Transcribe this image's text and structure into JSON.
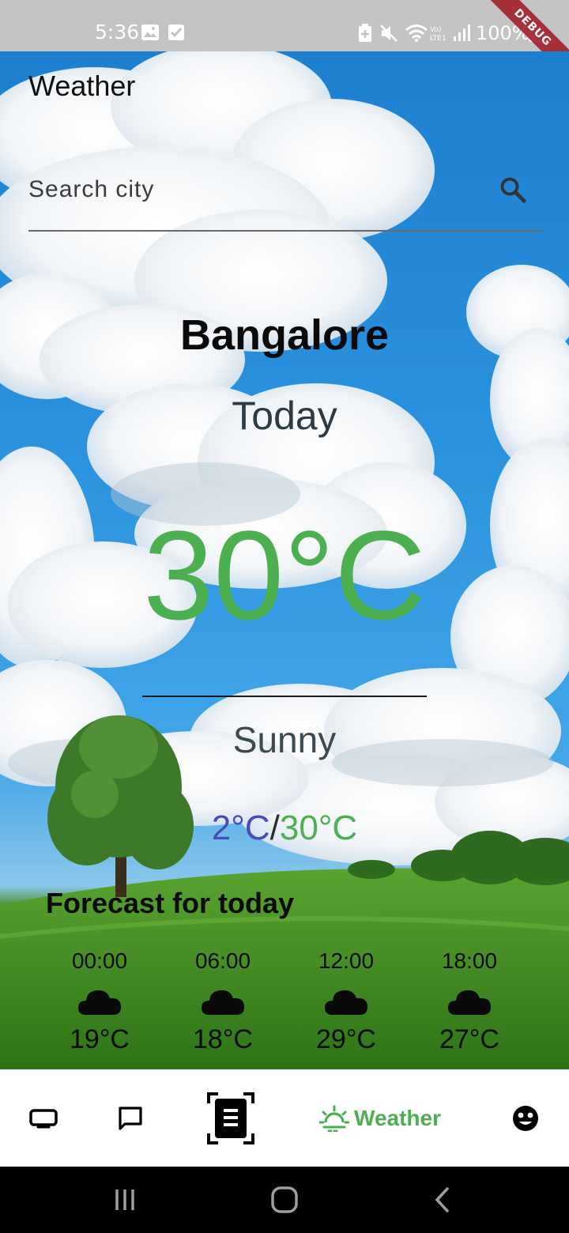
{
  "status": {
    "time": "5:36",
    "battery": "100%",
    "debug_label": "DEBUG"
  },
  "app": {
    "title": "Weather"
  },
  "search": {
    "placeholder": "Search city",
    "value": ""
  },
  "weather": {
    "city": "Bangalore",
    "day": "Today",
    "temperature": "30°C",
    "condition": "Sunny",
    "min": "2°C",
    "separator": "/",
    "max": "30°C"
  },
  "forecast": {
    "title": "Forecast for today",
    "items": [
      {
        "time": "00:00",
        "temp": "19°C",
        "icon": "cloud-icon"
      },
      {
        "time": "06:00",
        "temp": "18°C",
        "icon": "cloud-icon"
      },
      {
        "time": "12:00",
        "temp": "29°C",
        "icon": "cloud-icon"
      },
      {
        "time": "18:00",
        "temp": "27°C",
        "icon": "cloud-icon"
      }
    ]
  },
  "nav": {
    "items": [
      {
        "icon": "tv-icon",
        "active": false
      },
      {
        "icon": "chat-icon",
        "active": false
      },
      {
        "icon": "document-scan-icon",
        "active": false
      },
      {
        "icon": "sun-icon",
        "label": "Weather",
        "active": true
      },
      {
        "icon": "face-icon",
        "active": false
      }
    ]
  },
  "colors": {
    "accent": "#4caf50",
    "min_temp": "#4a4ab8"
  }
}
